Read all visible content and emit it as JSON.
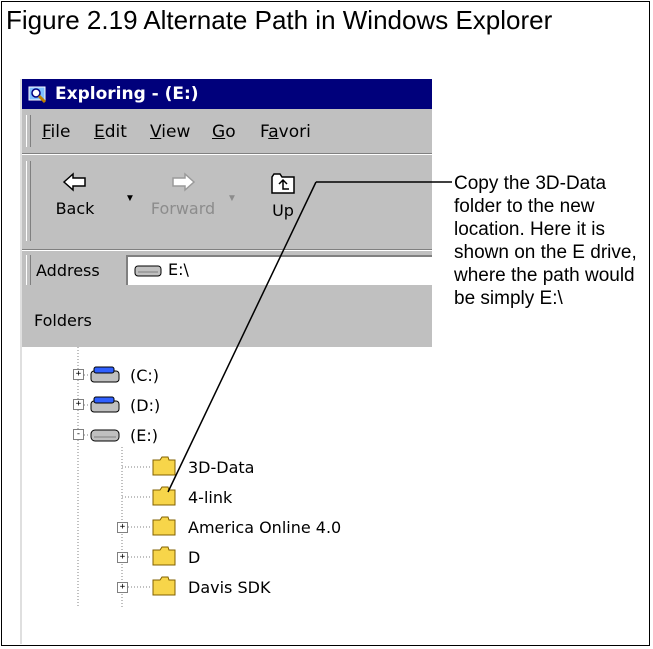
{
  "figure": {
    "caption": "Figure 2.19  Alternate Path in Windows Explorer",
    "callout": "Copy the 3D-Data folder to the new location. Here it is shown on the E drive, where the path would be simply E:\\"
  },
  "window": {
    "title": "Exploring - (E:)",
    "menu": [
      "File",
      "Edit",
      "View",
      "Go",
      "Favori"
    ],
    "toolbar": {
      "back": "Back",
      "forward": "Forward",
      "up": "Up"
    },
    "address": {
      "label": "Address",
      "value": "E:\\"
    },
    "folders_header": "Folders",
    "tree": [
      {
        "label": "(C:)",
        "kind": "drive",
        "expander": "+"
      },
      {
        "label": "(D:)",
        "kind": "drive",
        "expander": "+"
      },
      {
        "label": "(E:)",
        "kind": "drive",
        "expander": "-"
      },
      {
        "label": "3D-Data",
        "kind": "folder",
        "expander": ""
      },
      {
        "label": "4-link",
        "kind": "folder",
        "expander": ""
      },
      {
        "label": "America Online 4.0",
        "kind": "folder",
        "expander": "+"
      },
      {
        "label": "D",
        "kind": "folder",
        "expander": "+"
      },
      {
        "label": "Davis SDK",
        "kind": "folder",
        "expander": "+"
      }
    ]
  },
  "colors": {
    "titlebar": "#00007b",
    "face": "#c0c0c0",
    "folder": "#f7d54a"
  }
}
